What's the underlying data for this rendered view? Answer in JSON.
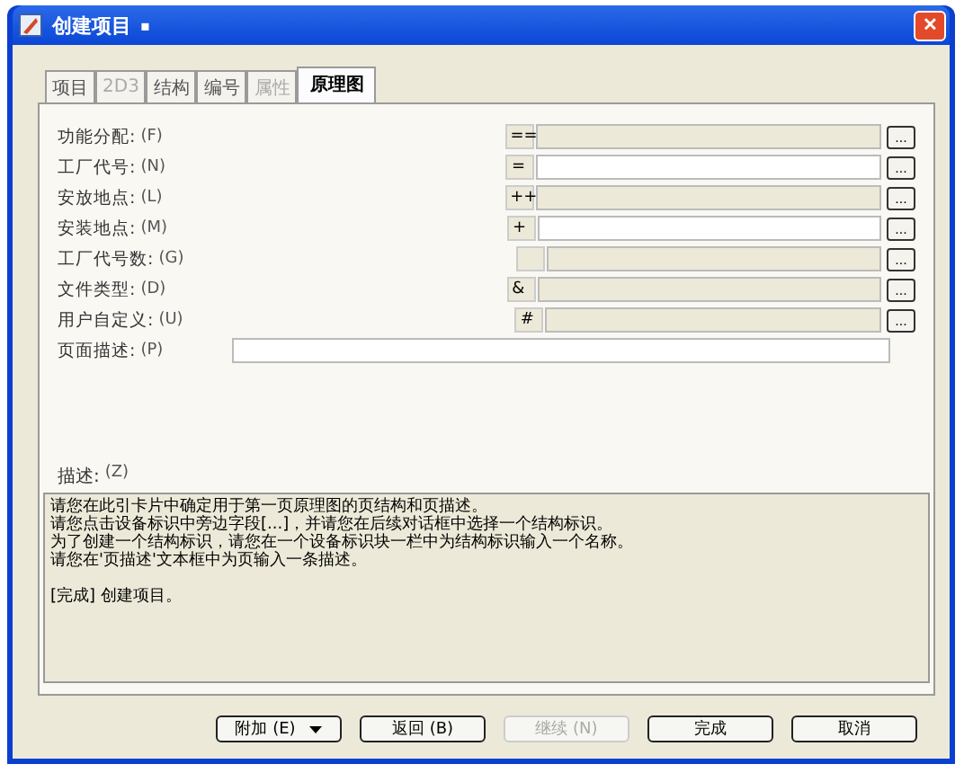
{
  "window": {
    "title": "创建项目",
    "title_mark": "▪",
    "close": "✕"
  },
  "tabs": [
    {
      "label": "项目",
      "selected": false,
      "disabled": false
    },
    {
      "label": "2D3",
      "selected": false,
      "disabled": true
    },
    {
      "label": "结构",
      "selected": false,
      "disabled": false
    },
    {
      "label": "编号",
      "selected": false,
      "disabled": false
    },
    {
      "label": "属性",
      "selected": false,
      "disabled": true
    },
    {
      "label": "原理图",
      "selected": true,
      "disabled": false
    }
  ],
  "fields": [
    {
      "label": "功能分配:",
      "hotkey": "(F)",
      "prefix": "==",
      "editable": false,
      "browse": "..."
    },
    {
      "label": "工厂代号:",
      "hotkey": "(N)",
      "prefix": "=",
      "editable": true,
      "browse": "..."
    },
    {
      "label": "安放地点:",
      "hotkey": "(L)",
      "prefix": "++",
      "editable": false,
      "browse": "..."
    },
    {
      "label": "安装地点:",
      "hotkey": "(M)",
      "prefix": "+",
      "editable": true,
      "browse": "..."
    },
    {
      "label": "工厂代号数:",
      "hotkey": "(G)",
      "editable": false,
      "browse": "..."
    },
    {
      "label": "文件类型:",
      "hotkey": "(D)",
      "prefix": "&",
      "editable": false,
      "browse": "..."
    },
    {
      "label": "用户自定义:",
      "hotkey": "(U)",
      "prefix": "#",
      "editable": false,
      "browse": "..."
    },
    {
      "label": "页面描述:",
      "hotkey": "(P)",
      "editable": true
    }
  ],
  "description": {
    "label": "描述:",
    "hotkey": "(Z)",
    "paragraphs": [
      [
        "请您在此引卡片中确定用于第一页原理图的页结构和页描述。",
        "请您点击设备标识中旁边字段[...]，并请您在后续对话框中选择一个结构标识。",
        "为了创建一个结构标识，请您在一个设备标识块一栏中为结构标识输入一个名称。",
        "请您在'页描述'文本框中为页输入一条描述。"
      ],
      [
        "[完成] 创建项目。"
      ]
    ]
  },
  "buttons": [
    {
      "label": "附加 (E)",
      "kind": "menu",
      "disabled": false
    },
    {
      "label": "返回 (B)",
      "kind": "plain",
      "disabled": false
    },
    {
      "label": "继续 (N)",
      "kind": "plain",
      "disabled": true
    },
    {
      "label": "完成",
      "kind": "plain",
      "disabled": false
    },
    {
      "label": "取消",
      "kind": "plain",
      "disabled": false
    }
  ]
}
